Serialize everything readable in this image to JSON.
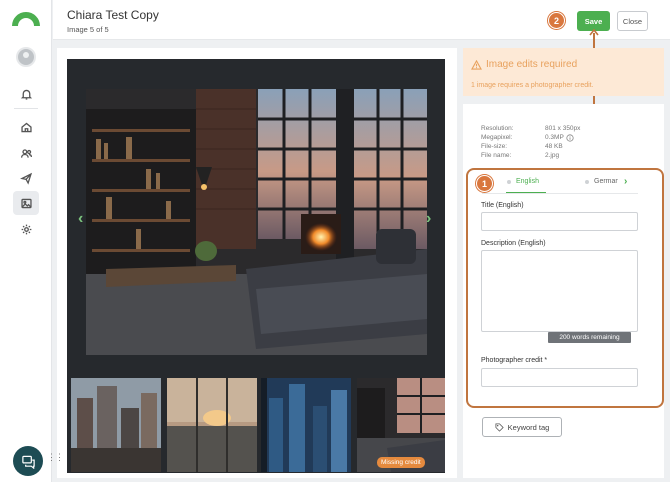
{
  "header": {
    "title": "Chiara Test Copy",
    "subtitle": "Image 5 of 5",
    "save_label": "Save",
    "close_label": "Close",
    "step2": "2"
  },
  "alert": {
    "title": "Image edits required",
    "message": "1 image requires a photographer credit."
  },
  "meta": {
    "resolution_label": "Resolution:",
    "resolution_value": "801 x 350px",
    "megapixel_label": "Megapixel:",
    "megapixel_value": "0.3MP",
    "filesize_label": "File-size:",
    "filesize_value": "48 KB",
    "filename_label": "File name:",
    "filename_value": "2.jpg"
  },
  "form": {
    "step1": "1",
    "tab_english": "English",
    "tab_german": "German",
    "title_label": "Title (English)",
    "description_label": "Description (English)",
    "words_remaining": "200 words remaining",
    "credit_label": "Photographer credit *",
    "keyword_label": "Keyword tag"
  },
  "thumbs": {
    "missing_credit": "Missing credit"
  },
  "colors": {
    "brand_green": "#4caf50",
    "accent_orange": "#d9773e",
    "alert_bg": "#fde9d6",
    "alert_text": "#e8a15d"
  },
  "icons": [
    "bell-icon",
    "home-icon",
    "users-icon",
    "send-icon",
    "image-icon",
    "gear-icon",
    "warning-icon",
    "info-icon",
    "tag-icon",
    "chat-icon",
    "chevron-left-icon",
    "chevron-right-icon"
  ]
}
